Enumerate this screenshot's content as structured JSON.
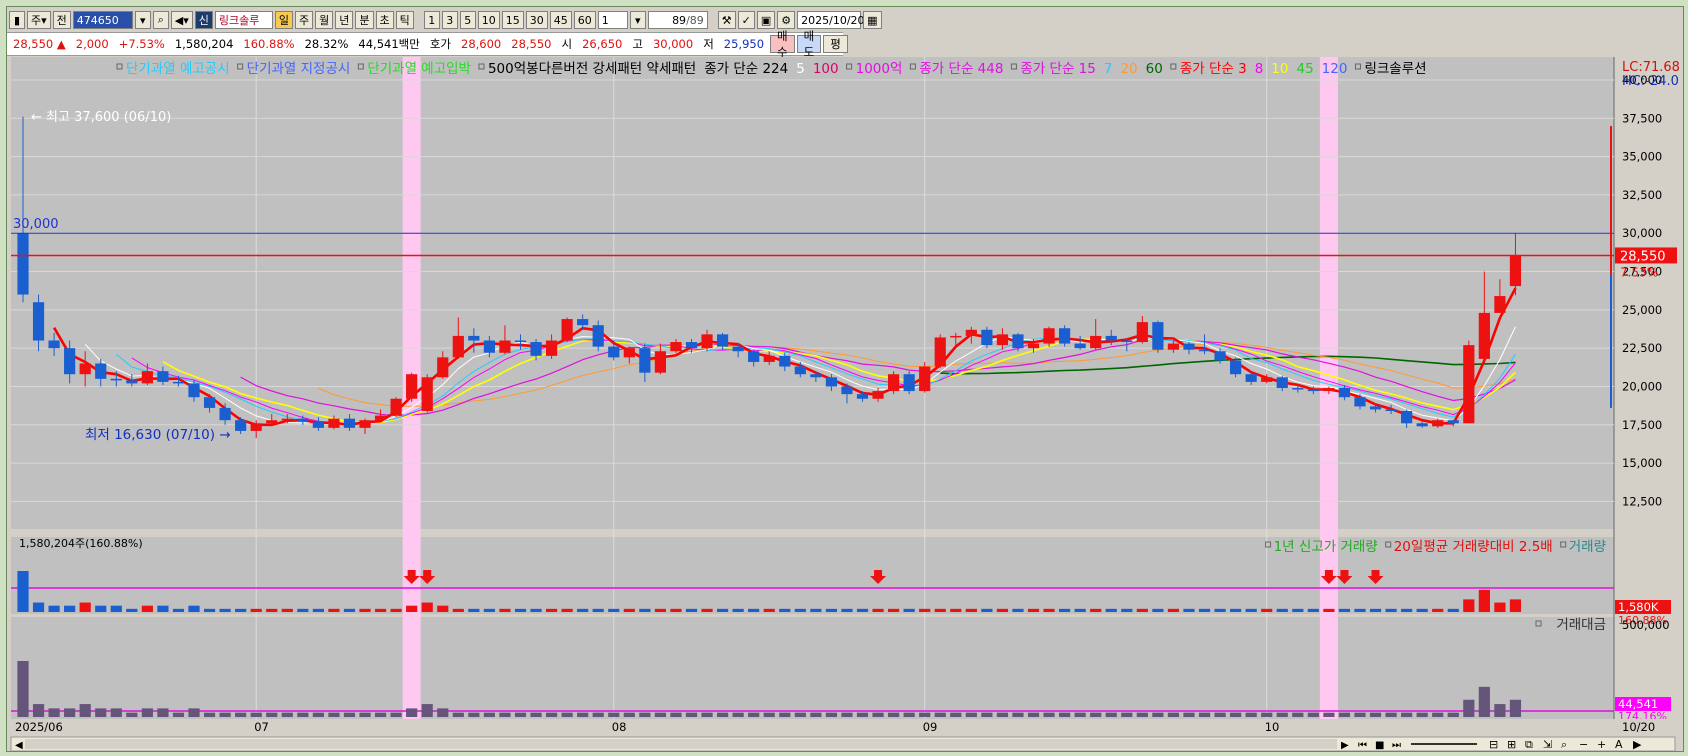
{
  "toolbar": {
    "market": "주",
    "prev": "전",
    "code": "474650",
    "name": "링크솔루",
    "period_active": "일",
    "periods": [
      "주",
      "월",
      "년",
      "분",
      "초",
      "틱"
    ],
    "nums": [
      "1",
      "3",
      "5",
      "10",
      "15",
      "30",
      "45",
      "60"
    ],
    "num_select": "1",
    "count": "89",
    "count_total": "/89",
    "date": "2025/10/20"
  },
  "quote": {
    "price": "28,550",
    "change": "2,000",
    "change_pct": "+7.53%",
    "volume": "1,580,204",
    "vol_ratio": "160.88%",
    "turnover": "28.32%",
    "amount": "44,541백만",
    "hoga_label": "호가",
    "hoga1": "28,600",
    "hoga2": "28,550",
    "open_label": "시",
    "open": "26,650",
    "high_label": "고",
    "high": "30,000",
    "low_label": "저",
    "low": "25,950",
    "buy": "매수",
    "sell": "매도",
    "eval": "평"
  },
  "legend_top": [
    {
      "t": "단기과열 예고공시",
      "c": "#22ccff"
    },
    {
      "t": "단기과열 지정공시",
      "c": "#4466ff"
    },
    {
      "t": "단기과열 예고입박",
      "c": "#22dd22"
    },
    {
      "t": "500억봉다른버전 강세패턴  약세패턴",
      "c": "#000000"
    },
    {
      "t": "종가 단순 224",
      "c": "#000000"
    },
    {
      "t": "5",
      "c": "#ffffff"
    },
    {
      "t": "100",
      "c": "#e0006a"
    },
    {
      "t": "1000억",
      "c": "#e010e0"
    },
    {
      "t": "종가 단순 448",
      "c": "#e010e0"
    },
    {
      "t": "종가 단순 15",
      "c": "#e010e0"
    },
    {
      "t": "7",
      "c": "#22ccff"
    },
    {
      "t": "20",
      "c": "#ff9933"
    },
    {
      "t": "60",
      "c": "#006600"
    },
    {
      "t": "종가 단순 3",
      "c": "#ff0000"
    },
    {
      "t": "8",
      "c": "#ff00ff"
    },
    {
      "t": "10",
      "c": "#ffff00"
    },
    {
      "t": "45",
      "c": "#22cc22"
    },
    {
      "t": "120",
      "c": "#4466ff"
    },
    {
      "t": "링크솔루션",
      "c": "#000000"
    }
  ],
  "lc_hc": {
    "lc": "LC:71.68",
    "hc": "HC:-24.0"
  },
  "annotations": {
    "high_label": "최고 37,600 (06/10)",
    "low_label": "최저 16,630 (07/10)",
    "line_30000": "30,000",
    "price_tag": "28,550",
    "pct_tag": "7.53%"
  },
  "volume_panel": {
    "title": "1,580,204주(160.88%)",
    "legend": [
      {
        "t": "1년 신고가 거래량",
        "c": "#22aa22"
      },
      {
        "t": "20일평균 거래량대비 2.5배",
        "c": "#e01010"
      },
      {
        "t": "거래량",
        "c": "#2a8a8a"
      }
    ],
    "tag1": "1,580K",
    "tag2": "160.88%"
  },
  "amount_panel": {
    "legend": "거래대금",
    "axis": "500,000",
    "tag1": "44,541",
    "tag2": "174.16%"
  },
  "xaxis": {
    "labels": [
      "2025/06",
      "07",
      "08",
      "09",
      "10"
    ],
    "last": "10/20"
  },
  "colors": {
    "bg": "#c0c0c0",
    "up": "#ee1111",
    "down": "#1a5fd0",
    "highlight": "#ffc8f0"
  },
  "chart_data": {
    "type": "candlestick",
    "y_ticks": [
      12500,
      15000,
      17500,
      20000,
      22500,
      25000,
      27500,
      30000,
      32500,
      35000,
      37500,
      40000
    ],
    "ylim": [
      10700,
      41500
    ],
    "month_starts": [
      {
        "i": 0,
        "label": "2025/06"
      },
      {
        "i": 15,
        "label": "07"
      },
      {
        "i": 38,
        "label": "08"
      },
      {
        "i": 58,
        "label": "09"
      },
      {
        "i": 80,
        "label": "10"
      }
    ],
    "highlight_days": [
      25,
      84
    ],
    "signal_days": [
      25,
      26,
      55,
      84,
      85,
      87
    ],
    "candles": [
      [
        30000,
        26000,
        37600,
        25500
      ],
      [
        25500,
        23000,
        26000,
        22300
      ],
      [
        23000,
        22500,
        23500,
        22000
      ],
      [
        22500,
        20800,
        23000,
        20200
      ],
      [
        20800,
        21500,
        22300,
        20000
      ],
      [
        21500,
        20500,
        21800,
        20000
      ],
      [
        20500,
        20400,
        21000,
        20000
      ],
      [
        20400,
        20200,
        20800,
        20000
      ],
      [
        20200,
        21000,
        21500,
        20100
      ],
      [
        21000,
        20300,
        21300,
        20100
      ],
      [
        20300,
        20200,
        20700,
        20000
      ],
      [
        20200,
        19300,
        20400,
        19000
      ],
      [
        19300,
        18600,
        19500,
        18300
      ],
      [
        18600,
        17800,
        18900,
        17500
      ],
      [
        17800,
        17100,
        18000,
        16900
      ],
      [
        17100,
        17600,
        17800,
        16630
      ],
      [
        17600,
        17800,
        18200,
        17400
      ],
      [
        17800,
        17900,
        18200,
        17600
      ],
      [
        17900,
        17700,
        18100,
        17500
      ],
      [
        17700,
        17300,
        18000,
        17100
      ],
      [
        17300,
        17900,
        18100,
        17200
      ],
      [
        17900,
        17300,
        18200,
        17100
      ],
      [
        17300,
        17800,
        17900,
        16900
      ],
      [
        17800,
        18100,
        18500,
        17700
      ],
      [
        18100,
        19200,
        19300,
        18000
      ],
      [
        19200,
        20800,
        20900,
        19000
      ],
      [
        18400,
        20600,
        20800,
        18300
      ],
      [
        20600,
        21900,
        22300,
        20500
      ],
      [
        21900,
        23300,
        24500,
        21800
      ],
      [
        23300,
        23000,
        23800,
        22200
      ],
      [
        23000,
        22200,
        23300,
        21900
      ],
      [
        22200,
        23000,
        24000,
        22100
      ],
      [
        23000,
        22900,
        23400,
        22400
      ],
      [
        22900,
        22000,
        23100,
        21700
      ],
      [
        22000,
        23000,
        23400,
        21800
      ],
      [
        23000,
        24400,
        24500,
        22900
      ],
      [
        24400,
        24000,
        24700,
        23700
      ],
      [
        24000,
        22600,
        24300,
        22300
      ],
      [
        22600,
        21900,
        23000,
        21700
      ],
      [
        21900,
        22500,
        22600,
        21500
      ],
      [
        22500,
        20900,
        22800,
        20300
      ],
      [
        20900,
        22300,
        22800,
        20800
      ],
      [
        22300,
        22900,
        23100,
        22200
      ],
      [
        22900,
        22500,
        23100,
        22200
      ],
      [
        22500,
        23400,
        23700,
        22300
      ],
      [
        23400,
        22600,
        23500,
        22400
      ],
      [
        22600,
        22300,
        22800,
        21900
      ],
      [
        22300,
        21600,
        22400,
        21300
      ],
      [
        21600,
        22000,
        22300,
        21400
      ],
      [
        22000,
        21300,
        22200,
        21000
      ],
      [
        21300,
        20800,
        21600,
        20600
      ],
      [
        20800,
        20600,
        21000,
        20300
      ],
      [
        20600,
        20000,
        20800,
        19700
      ],
      [
        20000,
        19500,
        20200,
        18900
      ],
      [
        19500,
        19200,
        19700,
        19000
      ],
      [
        19200,
        19700,
        19900,
        19000
      ],
      [
        19700,
        20800,
        21000,
        19500
      ],
      [
        20800,
        19700,
        21000,
        19500
      ],
      [
        19700,
        21300,
        21600,
        19600
      ],
      [
        21300,
        23200,
        23400,
        21200
      ],
      [
        23200,
        23300,
        23500,
        22600
      ],
      [
        23300,
        23700,
        23900,
        22800
      ],
      [
        23700,
        22700,
        23900,
        22500
      ],
      [
        22700,
        23400,
        23800,
        22400
      ],
      [
        23400,
        22500,
        23500,
        22300
      ],
      [
        22500,
        22800,
        23100,
        22200
      ],
      [
        22800,
        23800,
        23900,
        22600
      ],
      [
        23800,
        22800,
        24000,
        22600
      ],
      [
        22800,
        22500,
        23300,
        22400
      ],
      [
        22500,
        23300,
        24400,
        22400
      ],
      [
        23300,
        23000,
        23700,
        22700
      ],
      [
        23000,
        22900,
        23100,
        22300
      ],
      [
        22900,
        24200,
        24600,
        22800
      ],
      [
        24200,
        22400,
        24300,
        22200
      ],
      [
        22400,
        22800,
        23000,
        22200
      ],
      [
        22800,
        22400,
        22900,
        22100
      ],
      [
        22400,
        22300,
        23400,
        22100
      ],
      [
        22300,
        21700,
        22500,
        21500
      ],
      [
        21700,
        20800,
        21900,
        20600
      ],
      [
        20800,
        20300,
        21000,
        20100
      ],
      [
        20300,
        20600,
        20800,
        20200
      ],
      [
        20600,
        19900,
        20700,
        19700
      ],
      [
        19900,
        19800,
        20100,
        19600
      ],
      [
        19800,
        19700,
        20000,
        19500
      ],
      [
        19700,
        19900,
        20000,
        19500
      ],
      [
        19900,
        19300,
        20100,
        19100
      ],
      [
        19300,
        18700,
        19500,
        18500
      ],
      [
        18700,
        18500,
        18900,
        18300
      ],
      [
        18500,
        18400,
        18800,
        18200
      ],
      [
        18400,
        17600,
        18500,
        17300
      ],
      [
        17600,
        17400,
        17700,
        17300
      ],
      [
        17400,
        17800,
        17900,
        17300
      ],
      [
        17800,
        17600,
        17800,
        17400
      ],
      [
        17600,
        22700,
        23000,
        17600
      ],
      [
        21800,
        24800,
        27500,
        21500
      ],
      [
        24800,
        25900,
        27000,
        24800
      ],
      [
        26550,
        28550,
        30000,
        25950
      ]
    ],
    "volume": [
      13,
      3,
      2,
      2,
      3,
      2,
      2,
      1,
      2,
      2,
      1,
      2,
      1,
      1,
      1,
      1,
      1,
      1,
      1,
      1,
      1,
      1,
      1,
      1,
      1,
      2,
      3,
      2,
      1,
      1,
      1,
      1,
      1,
      1,
      1,
      1,
      1,
      1,
      1,
      1,
      1,
      1,
      1,
      1,
      1,
      1,
      1,
      1,
      1,
      1,
      1,
      1,
      1,
      1,
      1,
      1,
      1,
      1,
      1,
      1,
      1,
      1,
      1,
      1,
      1,
      1,
      1,
      1,
      1,
      1,
      1,
      1,
      1,
      1,
      1,
      1,
      1,
      1,
      1,
      1,
      1,
      1,
      1,
      1,
      1,
      1,
      1,
      1,
      1,
      1,
      1,
      1,
      1,
      4,
      7,
      3,
      4
    ]
  }
}
